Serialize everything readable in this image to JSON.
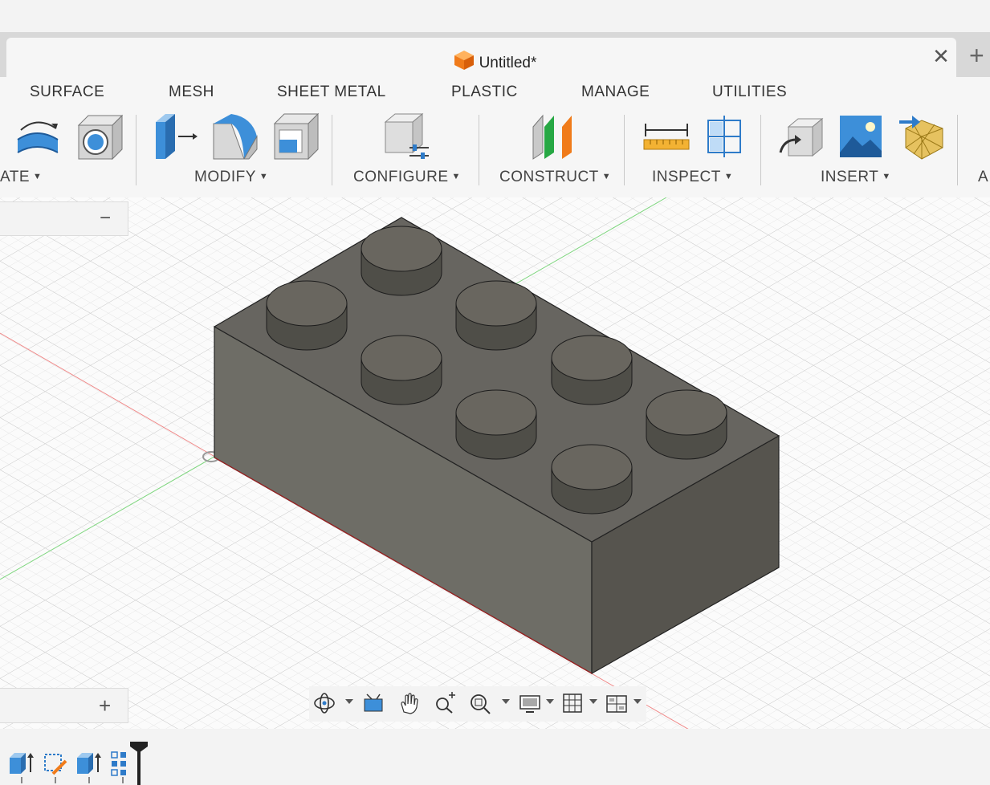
{
  "document": {
    "title": "Untitled*"
  },
  "tabs": [
    {
      "label": "SURFACE"
    },
    {
      "label": "MESH"
    },
    {
      "label": "SHEET METAL"
    },
    {
      "label": "PLASTIC"
    },
    {
      "label": "MANAGE"
    },
    {
      "label": "UTILITIES"
    }
  ],
  "groups": {
    "create": "ATE",
    "modify": "MODIFY",
    "configure": "CONFIGURE",
    "construct": "CONSTRUCT",
    "inspect": "INSPECT",
    "insert": "INSERT",
    "assemble": "A"
  },
  "panels": {
    "top_collapse": "−",
    "bottom_expand": "+"
  },
  "colors": {
    "accent": "#2e7bc9",
    "brick": "#6f6e68",
    "tool_orange": "#f07b1a"
  },
  "icons": [
    "sweep-icon",
    "shell-icon",
    "press-pull-icon",
    "fillet-icon",
    "chamfer-icon",
    "configure-icon",
    "offset-plane-icon",
    "midplane-icon",
    "measure-icon",
    "interference-icon",
    "insert-derive-icon",
    "decal-icon",
    "insert-mesh-icon",
    "orbit-icon",
    "look-at-icon",
    "pan-icon",
    "zoom-icon",
    "zoom-window-icon",
    "display-settings-icon",
    "grid-icon",
    "viewports-icon"
  ]
}
